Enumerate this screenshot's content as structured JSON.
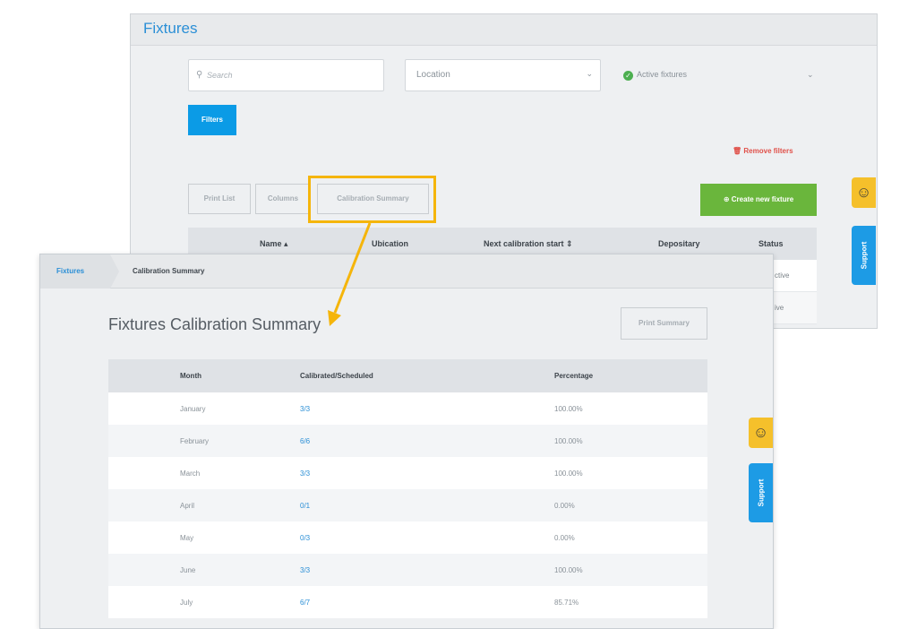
{
  "background_page": {
    "title": "Fixtures",
    "search": {
      "placeholder": "Search"
    },
    "location_select": {
      "value": "Location"
    },
    "active_filter": {
      "value": "Active fixtures"
    },
    "filters_button": "Filters",
    "remove_filters": "Remove filters",
    "toolbar": {
      "print_list": "Print List",
      "columns": "Columns",
      "calibration_summary": "Calibration Summary",
      "create_new": "Create new fixture"
    },
    "table": {
      "headers": {
        "name": "Name",
        "ubication": "Ubication",
        "next": "Next calibration start",
        "depositary": "Depositary",
        "status": "Status"
      },
      "visible_status_fragments": [
        "ctive",
        "ive"
      ]
    }
  },
  "side_widgets": {
    "support_label": "Support"
  },
  "summary_page": {
    "breadcrumb": {
      "root": "Fixtures",
      "current": "Calibration Summary"
    },
    "title": "Fixtures Calibration Summary",
    "print_button": "Print Summary",
    "table": {
      "headers": {
        "month": "Month",
        "calibrated": "Calibrated/Scheduled",
        "percentage": "Percentage"
      },
      "rows": [
        {
          "month": "January",
          "calibrated": "3/3",
          "percentage": "100.00%"
        },
        {
          "month": "February",
          "calibrated": "6/6",
          "percentage": "100.00%"
        },
        {
          "month": "March",
          "calibrated": "3/3",
          "percentage": "100.00%"
        },
        {
          "month": "April",
          "calibrated": "0/1",
          "percentage": "0.00%"
        },
        {
          "month": "May",
          "calibrated": "0/3",
          "percentage": "0.00%"
        },
        {
          "month": "June",
          "calibrated": "3/3",
          "percentage": "100.00%"
        },
        {
          "month": "July",
          "calibrated": "6/7",
          "percentage": "85.71%"
        }
      ]
    }
  },
  "colors": {
    "accent_blue": "#0b9be6",
    "link_blue": "#2b8fd6",
    "create_green": "#6ab63c",
    "callout_yellow": "#f5b50b",
    "remove_red": "#e0514a"
  }
}
